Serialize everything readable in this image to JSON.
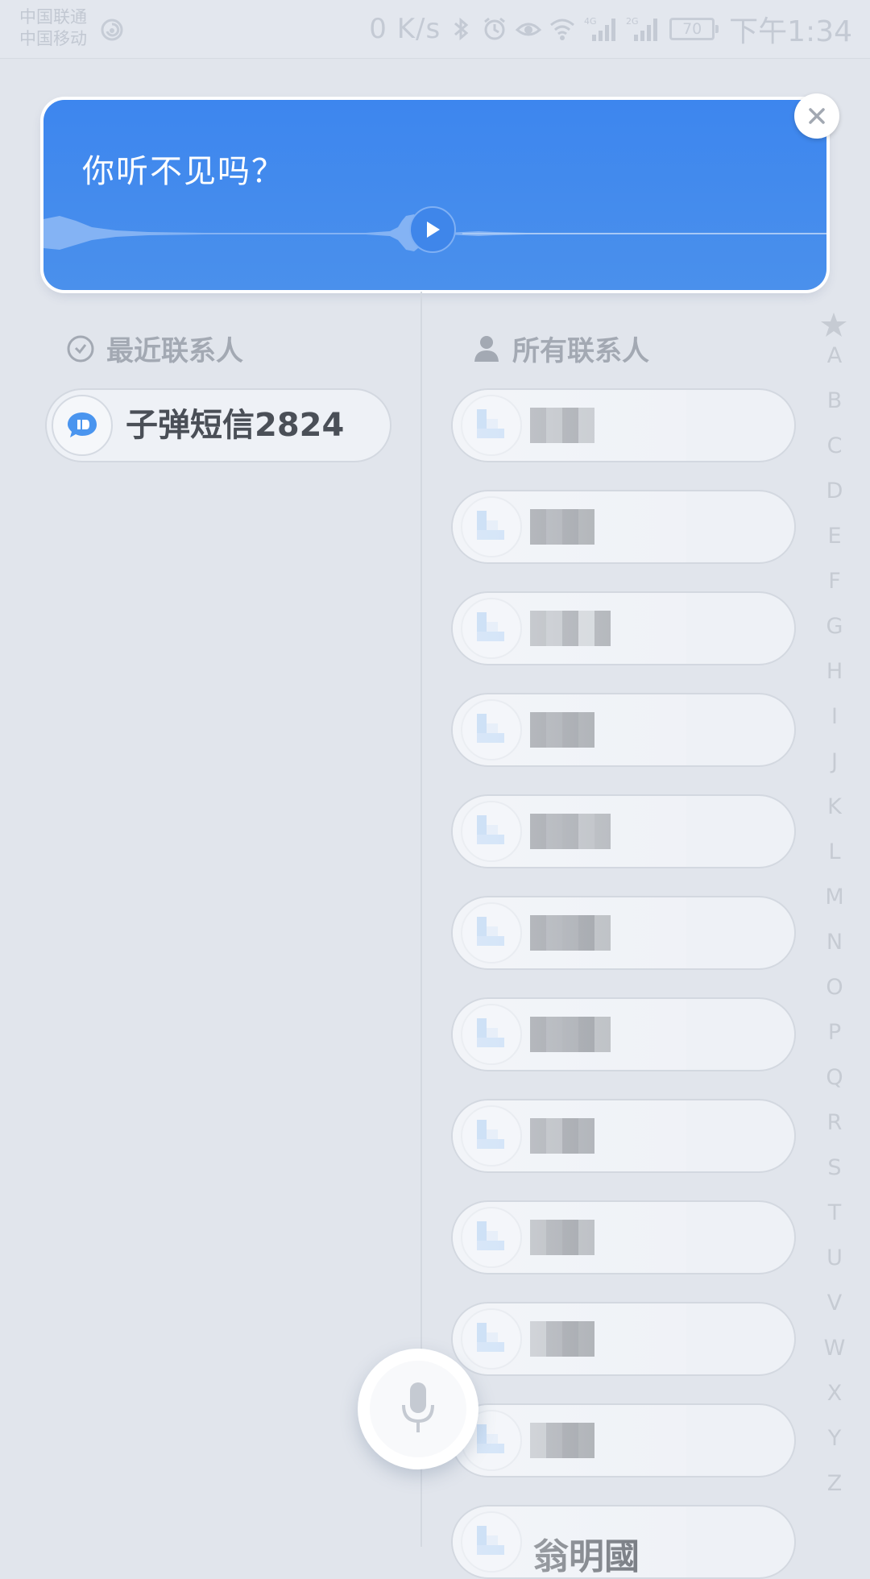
{
  "status_bar": {
    "carrier_1": "中国联通",
    "carrier_2": "中国移动",
    "net_speed": "0 K/s",
    "signal_1_label": "4G",
    "signal_2_label": "2G",
    "battery": "70",
    "time": "下午1:34"
  },
  "voice_card": {
    "text": "你听不见吗？",
    "accent_color": "#4a90ec"
  },
  "recent": {
    "heading": "最近联系人",
    "items": [
      {
        "name": "子弹短信2824",
        "icon": "chat-bubble-icon"
      }
    ]
  },
  "all_contacts": {
    "heading": "所有联系人",
    "count": 12,
    "last_partial_name": "翁明國"
  },
  "alphabet_index": {
    "star": "★",
    "letters": [
      "A",
      "B",
      "C",
      "D",
      "E",
      "F",
      "G",
      "H",
      "I",
      "J",
      "K",
      "L",
      "M",
      "N",
      "O",
      "P",
      "Q",
      "R",
      "S",
      "T",
      "U",
      "V",
      "W",
      "X",
      "Y",
      "Z"
    ]
  }
}
